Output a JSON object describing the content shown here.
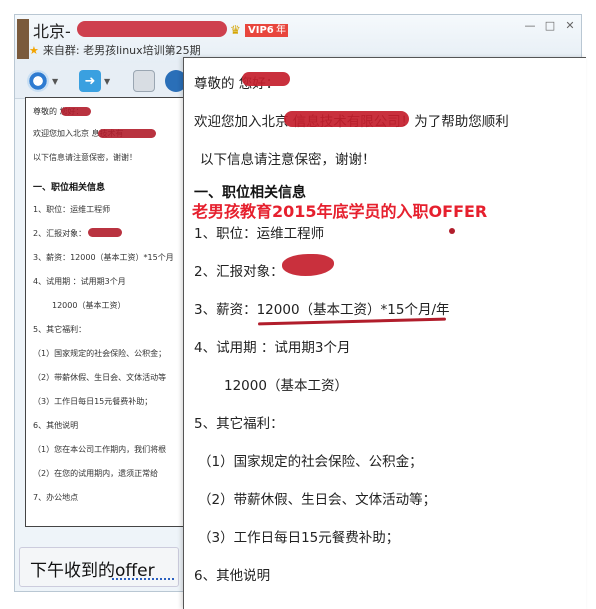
{
  "window": {
    "contact_name": "北京-",
    "vip_label": "VIP6",
    "year_label": "年",
    "from_group": "来自群:  老男孩linux培训第25期",
    "controls": [
      "—",
      "□",
      "✕"
    ]
  },
  "toolbar": {
    "items": [
      "webcam-icon",
      "file-transfer-icon",
      "app-icon",
      "share-icon"
    ]
  },
  "thumbnail": {
    "lines": [
      "尊敬的            您好：",
      "欢迎您加入北京                  息技术有",
      "以下信息请注意保密，谢谢！",
      "一、职位相关信息",
      "1、职位：运维工程师",
      "2、汇报对象：",
      "3、薪资：12000（基本工资）*15个月",
      "4、试用期 ：试用期3个月",
      "12000（基本工资）",
      "5、其它福利：",
      "（1）国家规定的社会保险、公积金；",
      "（2）带薪休假、生日会、文体活动等",
      "（3）工作日每日15元餐费补助；",
      "6、其他说明",
      "（1）您在本公司工作期内，我们将根",
      "（2）在您的试用期内，遗须正常给",
      "7、办公地点"
    ]
  },
  "input": {
    "text": "下午收到的offer"
  },
  "document": {
    "greeting": "尊敬的                  您好：",
    "welcome": "欢迎您加入北京                        信息技术有限公司！为了帮助您顺利",
    "confidential": "以下信息请注意保密，谢谢！",
    "section1": "一、职位相关信息",
    "overlay_caption": "老男孩教育2015年底学员的入职OFFER",
    "position": "1、职位：运维工程师",
    "report_to": "2、汇报对象：",
    "salary": "3、薪资：12000（基本工资）*15个月/年",
    "probation": "4、试用期 ：试用期3个月",
    "probation_salary": "12000（基本工资）",
    "benefits": "5、其它福利：",
    "benefit1": "（1）国家规定的社会保险、公积金；",
    "benefit2": "（2）带薪休假、生日会、文体活动等；",
    "benefit3": "（3）工作日每日15元餐费补助；",
    "other": "6、其他说明"
  },
  "colors": {
    "redaction": "#c41e2c",
    "caption": "#e6202e",
    "window_bg": "#eef4f9"
  }
}
